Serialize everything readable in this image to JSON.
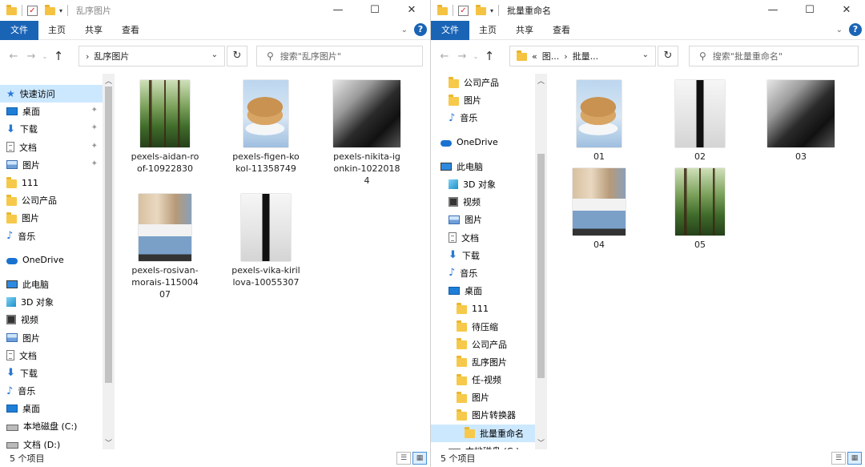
{
  "left": {
    "title": "乱序图片",
    "ribbon_tabs": [
      "文件",
      "主页",
      "共享",
      "查看"
    ],
    "address": [
      "乱序图片"
    ],
    "search_placeholder": "搜索\"乱序图片\"",
    "nav": [
      {
        "label": "快速访问",
        "icon": "star-icon",
        "pinned": false,
        "selected": true
      },
      {
        "label": "桌面",
        "icon": "desktop-icon",
        "pinned": true
      },
      {
        "label": "下载",
        "icon": "download-icon",
        "pinned": true
      },
      {
        "label": "文档",
        "icon": "document-icon",
        "pinned": true
      },
      {
        "label": "图片",
        "icon": "pictures-icon",
        "pinned": true
      },
      {
        "label": "111",
        "icon": "folder-icon"
      },
      {
        "label": "公司产品",
        "icon": "folder-icon"
      },
      {
        "label": "图片",
        "icon": "folder-icon"
      },
      {
        "label": "音乐",
        "icon": "music-icon"
      },
      {
        "label": "",
        "icon": "spacer"
      },
      {
        "label": "OneDrive",
        "icon": "onedrive-icon"
      },
      {
        "label": "",
        "icon": "spacer"
      },
      {
        "label": "此电脑",
        "icon": "pc-icon"
      },
      {
        "label": "3D 对象",
        "icon": "3d-objects-icon"
      },
      {
        "label": "视频",
        "icon": "video-icon"
      },
      {
        "label": "图片",
        "icon": "pictures-icon"
      },
      {
        "label": "文档",
        "icon": "document-icon"
      },
      {
        "label": "下载",
        "icon": "download-icon"
      },
      {
        "label": "音乐",
        "icon": "music-icon"
      },
      {
        "label": "桌面",
        "icon": "desktop-icon"
      },
      {
        "label": "本地磁盘 (C:)",
        "icon": "disk-icon"
      },
      {
        "label": "文档 (D:)",
        "icon": "disk-icon"
      }
    ],
    "files": [
      {
        "name": "pexels-aidan-roof-10922830",
        "thumb": "forest"
      },
      {
        "name": "pexels-figen-kokol-11358749",
        "thumb": "pancake"
      },
      {
        "name": "pexels-nikita-igonkin-10220184",
        "thumb": "bw"
      },
      {
        "name": "pexels-rosivan-morais-11500407",
        "thumb": "street"
      },
      {
        "name": "pexels-vika-kirillova-10055307",
        "thumb": "dress"
      }
    ],
    "status": "5 个项目"
  },
  "right": {
    "title": "批量重命名",
    "ribbon_tabs": [
      "文件",
      "主页",
      "共享",
      "查看"
    ],
    "address": [
      "«",
      "图...",
      "批量..."
    ],
    "search_placeholder": "搜索\"批量重命名\"",
    "nav": [
      {
        "label": "公司产品",
        "icon": "folder-icon",
        "indent": 1
      },
      {
        "label": "图片",
        "icon": "folder-icon",
        "indent": 1
      },
      {
        "label": "音乐",
        "icon": "music-icon",
        "indent": 1
      },
      {
        "label": "",
        "icon": "spacer"
      },
      {
        "label": "OneDrive",
        "icon": "onedrive-icon",
        "indent": 0
      },
      {
        "label": "",
        "icon": "spacer"
      },
      {
        "label": "此电脑",
        "icon": "pc-icon",
        "indent": 0
      },
      {
        "label": "3D 对象",
        "icon": "3d-objects-icon",
        "indent": 1
      },
      {
        "label": "视频",
        "icon": "video-icon",
        "indent": 1
      },
      {
        "label": "图片",
        "icon": "pictures-icon",
        "indent": 1
      },
      {
        "label": "文档",
        "icon": "document-icon",
        "indent": 1
      },
      {
        "label": "下载",
        "icon": "download-icon",
        "indent": 1
      },
      {
        "label": "音乐",
        "icon": "music-icon",
        "indent": 1
      },
      {
        "label": "桌面",
        "icon": "desktop-icon",
        "indent": 1
      },
      {
        "label": "111",
        "icon": "folder-icon",
        "indent": 2
      },
      {
        "label": "待压缩",
        "icon": "folder-icon",
        "indent": 2
      },
      {
        "label": "公司产品",
        "icon": "folder-icon",
        "indent": 2
      },
      {
        "label": "乱序图片",
        "icon": "folder-icon",
        "indent": 2
      },
      {
        "label": "任-视频",
        "icon": "folder-icon",
        "indent": 2
      },
      {
        "label": "图片",
        "icon": "folder-icon",
        "indent": 2
      },
      {
        "label": "图片转换器",
        "icon": "folder-icon",
        "indent": 2
      },
      {
        "label": "批量重命名",
        "icon": "folder-icon",
        "indent": 3,
        "selected": true
      },
      {
        "label": "本地磁盘 (C:)",
        "icon": "disk-icon",
        "indent": 1
      }
    ],
    "files": [
      {
        "name": "01",
        "thumb": "pancake"
      },
      {
        "name": "02",
        "thumb": "dress"
      },
      {
        "name": "03",
        "thumb": "bw"
      },
      {
        "name": "04",
        "thumb": "street"
      },
      {
        "name": "05",
        "thumb": "forest"
      }
    ],
    "status": "5 个项目"
  },
  "icons": {
    "back": "←",
    "forward": "→",
    "recent": "⌄",
    "up": "↑",
    "minimize": "—",
    "maximize": "☐",
    "close": "✕",
    "refresh": "↻",
    "search": "⚲",
    "pin": "✦",
    "help": "?"
  },
  "colors": {
    "accent": "#1a64b6",
    "selection": "#cce8ff",
    "folder": "#f7c94a"
  }
}
